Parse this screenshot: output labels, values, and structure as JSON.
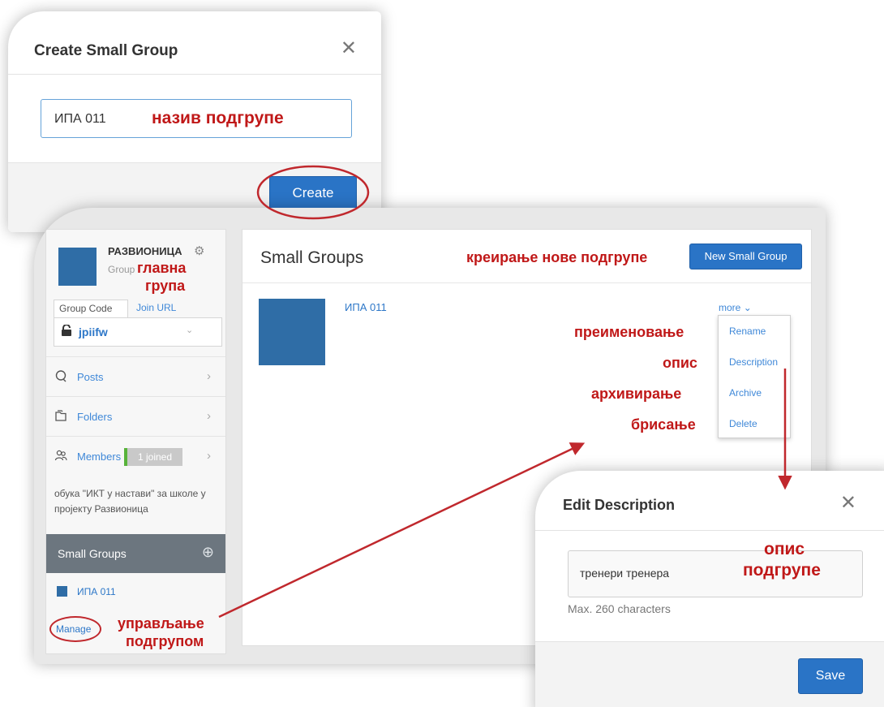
{
  "create_dialog": {
    "title": "Create Small Group",
    "close_icon": "close-icon",
    "input_value": "ИПА 011",
    "create_label": "Create"
  },
  "annotations": {
    "subgroup_name": "назив подгрупе",
    "create_new_subgroup": "креирање нове подгрупе",
    "main_group_1": "главна",
    "main_group_2": "група",
    "rename": "преименовање",
    "description": "опис",
    "archive": "архивирање",
    "delete": "брисање",
    "subgroup_desc_1": "опис",
    "subgroup_desc_2": "подгрупе",
    "manage_1": "управљање",
    "manage_2": "подгрупом",
    "color": "#c01818"
  },
  "sidebar": {
    "group_name": "РАЗВИОНИЦА",
    "group_type": "Group",
    "tabs": [
      "Group Code",
      "Join URL"
    ],
    "group_code": "jpiifw",
    "nav": [
      {
        "label": "Posts",
        "icon": "posts-icon"
      },
      {
        "label": "Folders",
        "icon": "folders-icon"
      },
      {
        "label": "Members",
        "icon": "members-icon",
        "badge": "1 joined"
      }
    ],
    "description": "обука \"ИКТ у настави\" за школе у пројекту Развионица",
    "small_groups_header": "Small Groups",
    "small_groups": [
      "ИПА 011"
    ],
    "manage_label": "Manage"
  },
  "content": {
    "title": "Small Groups",
    "new_button": "New Small Group",
    "group_link": "ИПА 011",
    "more_label": "more",
    "menu": [
      "Rename",
      "Description",
      "Archive",
      "Delete"
    ]
  },
  "edit_dialog": {
    "title": "Edit Description",
    "input_value": "тренери тренера",
    "hint": "Max. 260 characters",
    "save_label": "Save"
  },
  "colors": {
    "primary": "#2a74c6",
    "link": "#2d77c8",
    "avatar": "#2f6da6",
    "sidebar_header": "#6c767f",
    "joined_accent": "#58b33a",
    "annotation": "#c01818"
  }
}
